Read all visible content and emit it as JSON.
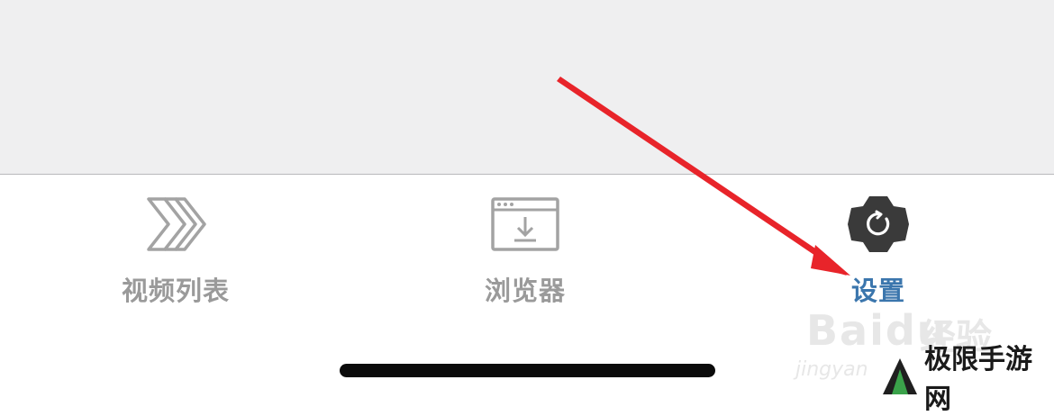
{
  "tabbar": {
    "tabs": [
      {
        "label": "视频列表",
        "icon": "chevrons-right-icon",
        "active": false
      },
      {
        "label": "浏览器",
        "icon": "browser-download-icon",
        "active": false
      },
      {
        "label": "设置",
        "icon": "gear-icon",
        "active": true
      }
    ]
  },
  "watermark": {
    "baidu": "Baidu",
    "jing": "经验",
    "sub": "jingyan"
  },
  "brand": {
    "name": "极限手游网",
    "logo": "mountain-logo-icon"
  },
  "colors": {
    "active": "#3b76ad",
    "inactive": "#9a9a9a",
    "background": "#efeff0",
    "annotation_arrow": "#e8242a"
  }
}
